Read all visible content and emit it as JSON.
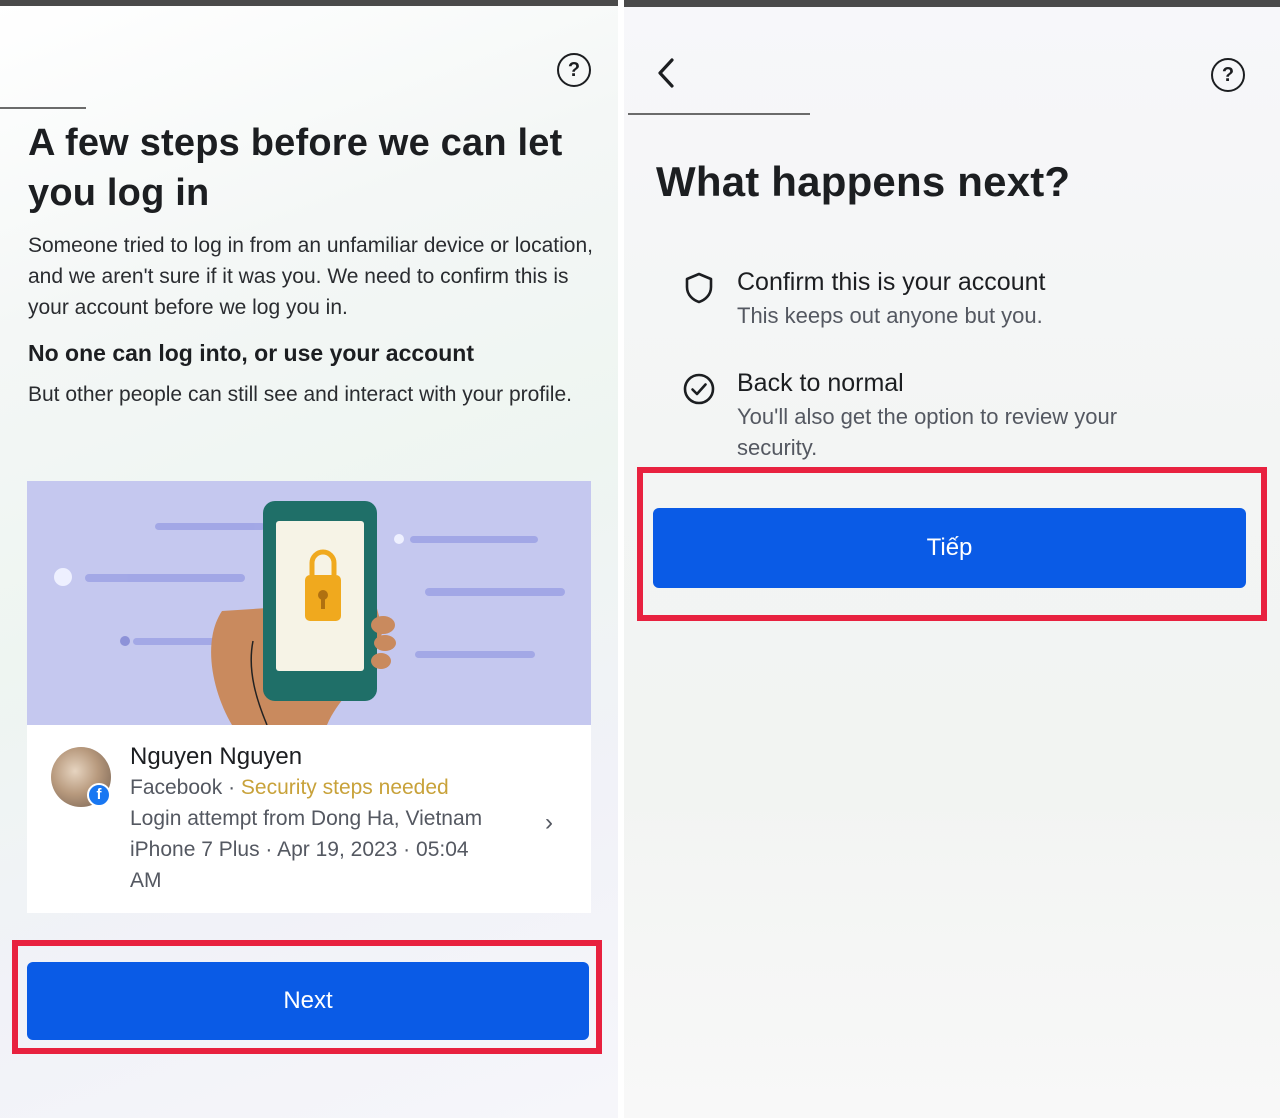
{
  "left": {
    "help_icon": "question-circle-icon",
    "help_label": "?",
    "title": "A few steps before we can let you log in",
    "intro": "Someone tried to log in from an unfamiliar device or location, and we aren't sure if it was you. We need to confirm this is your account before we log you in.",
    "subhead": "No one can log into, or use your account",
    "subtext": "But other people can still see and interact with your profile.",
    "illustration_icon": "phone-lock-icon",
    "login_card": {
      "name": "Nguyen Nguyen",
      "platform": "Facebook",
      "separator": "·",
      "status": "Security steps needed",
      "status_color": "#c8a23a",
      "detail_1": "Login attempt from Dong Ha, Vietnam",
      "detail_2": "iPhone 7 Plus · Apr 19, 2023 · 05:04",
      "detail_3": "AM",
      "chevron": "›",
      "badge_letter": "f"
    },
    "next_button": "Next"
  },
  "right": {
    "back_icon": "chevron-left-icon",
    "help_icon": "question-circle-icon",
    "help_label": "?",
    "title": "What happens next?",
    "steps": [
      {
        "icon": "shield-icon",
        "title": "Confirm this is your account",
        "desc": "This keeps out anyone but you."
      },
      {
        "icon": "check-circle-icon",
        "title": "Back to normal",
        "desc": "You'll also get the option to review your security."
      }
    ],
    "continue_button": "Tiếp"
  },
  "colors": {
    "primary": "#0a5be6",
    "highlight_frame": "#e8213f",
    "text": "#1c1e21",
    "secondary_text": "#545861"
  }
}
